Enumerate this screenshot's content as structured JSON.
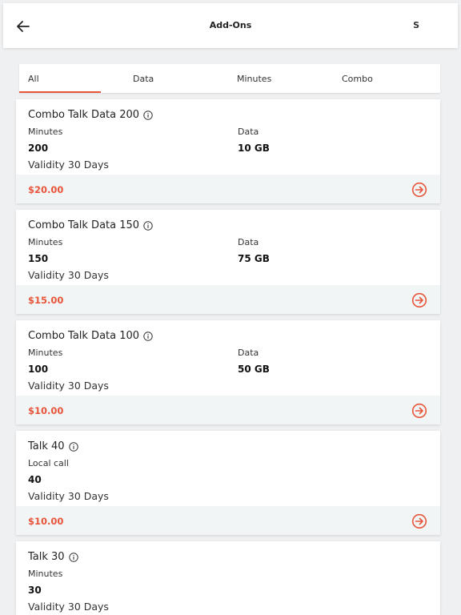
{
  "header": {
    "title": "Add-Ons",
    "right_text": "S",
    "back_icon": "arrow-left-icon"
  },
  "tabs": [
    {
      "label": "All",
      "active": true
    },
    {
      "label": "Data",
      "active": false
    },
    {
      "label": "Minutes",
      "active": false
    },
    {
      "label": "Combo",
      "active": false
    }
  ],
  "colors": {
    "accent": "#e8553b",
    "footer_bg": "#f1f5f5",
    "page_bg": "#eef0f2"
  },
  "cards": [
    {
      "title": "Combo Talk Data 200",
      "left_label": "Minutes",
      "left_value": "200",
      "right_label": "Data",
      "right_value": "10 GB",
      "validity": "Validity 30 Days",
      "price": "$20.00"
    },
    {
      "title": "Combo Talk Data 150",
      "left_label": "Minutes",
      "left_value": "150",
      "right_label": "Data",
      "right_value": "75 GB",
      "validity": "Validity 30 Days",
      "price": "$15.00"
    },
    {
      "title": "Combo Talk Data 100",
      "left_label": "Minutes",
      "left_value": "100",
      "right_label": "Data",
      "right_value": "50 GB",
      "validity": "Validity 30 Days",
      "price": "$10.00"
    },
    {
      "title": "Talk 40",
      "left_label": "Local call",
      "left_value": "40",
      "validity": "Validity 30 Days",
      "price": "$10.00"
    },
    {
      "title": "Talk 30",
      "left_label": "Minutes",
      "left_value": "30",
      "validity": "Validity 30 Days"
    }
  ]
}
